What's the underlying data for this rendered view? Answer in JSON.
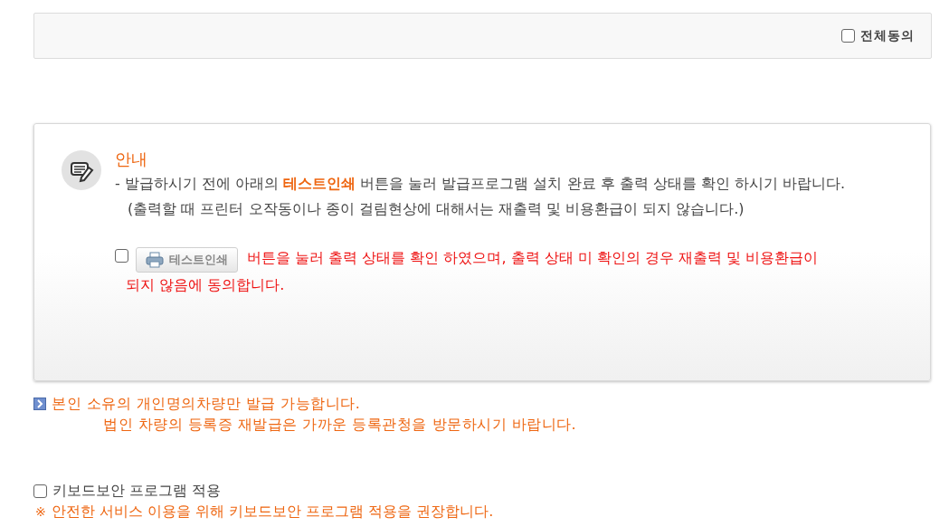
{
  "agree_all": {
    "label": "전체동의",
    "checked": false
  },
  "notice": {
    "title": "안내",
    "lines": [
      "- 발급하시기 전에 아래의 **테스트인쇄** 버튼을 눌러 발급프로그램 설치 완료 후 출력 상태를 확인 하시기 바랍니다.",
      "(출력할 때 프린터 오작동이나 종이 걸림현상에 대해서는 재출력 및 비용환급이 되지 않습니다.)"
    ],
    "consent": {
      "checked": false,
      "button": "테스트인쇄",
      "text": "버튼을 눌러 출력 상태를 확인 하였으며, 출력 상태 미 확인의 경우 재출력 및 비용환급이",
      "text_2": "되지 않음에 동의합니다."
    }
  },
  "vehicle_note": {
    "text": "본인 소유의 개인명의차량만 발급 가능합니다.",
    "text_2": "법인 차량의 등록증 재발급은 가까운 등록관청을 방문하시기 바랍니다."
  },
  "keyboard_security": {
    "label": "키보드보안 프로그램 적용",
    "checked": false,
    "mark": "※",
    "note": "안전한 서비스 이용을 위해 키보드보안 프로그램 적용을 권장합니다."
  }
}
